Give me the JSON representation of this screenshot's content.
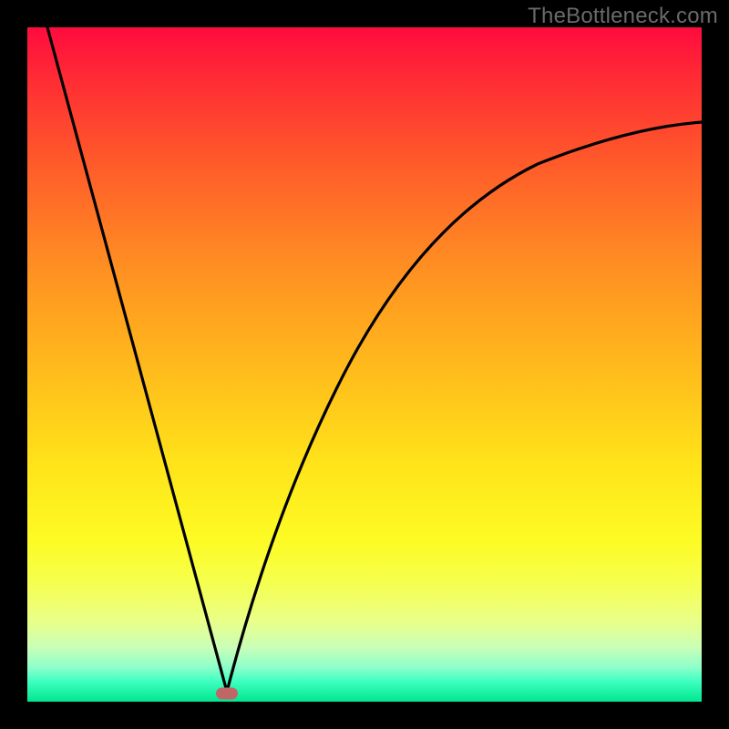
{
  "watermark": "TheBottleneck.com",
  "colors": {
    "frame": "#000000",
    "curve": "#000000",
    "marker": "#c06666",
    "gradient_top": "#ff0b3e",
    "gradient_bottom": "#00e78f"
  },
  "chart_data": {
    "type": "line",
    "title": "",
    "xlabel": "",
    "ylabel": "",
    "xlim": [
      0,
      100
    ],
    "ylim": [
      0,
      100
    ],
    "series": [
      {
        "name": "left-branch",
        "x": [
          3,
          6,
          9,
          12,
          15,
          18,
          21,
          24,
          27,
          29.5
        ],
        "values": [
          100,
          89,
          78,
          67,
          56,
          44.5,
          33.5,
          22,
          11,
          1.5
        ]
      },
      {
        "name": "right-branch",
        "x": [
          29.5,
          33,
          37,
          41,
          46,
          51,
          57,
          64,
          72,
          80,
          88,
          96,
          100
        ],
        "values": [
          1.5,
          14,
          27,
          38,
          49,
          57.5,
          65.5,
          72.5,
          78.5,
          82,
          84.2,
          85.6,
          86
        ]
      }
    ],
    "annotations": [
      {
        "name": "optimum-marker",
        "x": 29.5,
        "y": 1.2
      }
    ],
    "background": "vertical-gradient red→orange→yellow→green"
  }
}
